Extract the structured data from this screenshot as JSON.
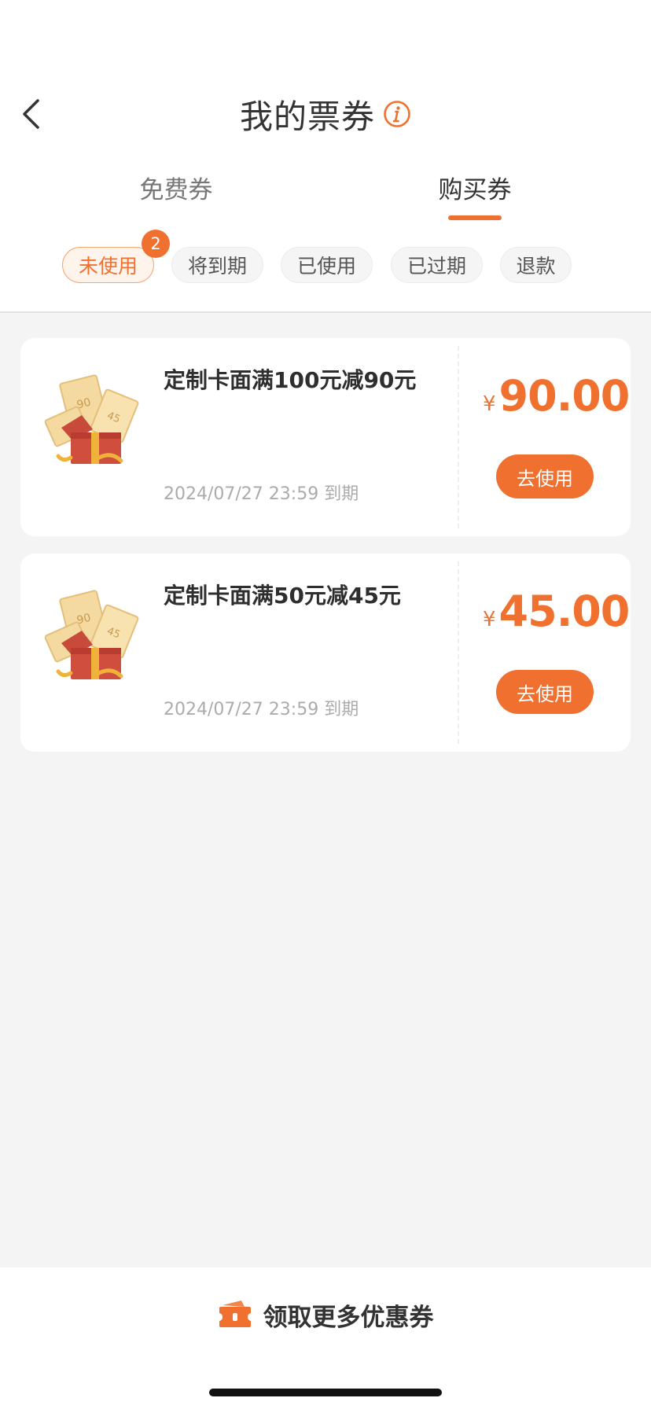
{
  "header": {
    "title": "我的票券"
  },
  "tabs": [
    {
      "label": "免费券"
    },
    {
      "label": "购买券"
    }
  ],
  "filters": [
    {
      "label": "未使用",
      "badge": "2"
    },
    {
      "label": "将到期"
    },
    {
      "label": "已使用"
    },
    {
      "label": "已过期"
    },
    {
      "label": "退款"
    }
  ],
  "coupons": [
    {
      "title": "定制卡面满100元减90元",
      "expire": "2024/07/27 23:59 到期",
      "currency": "¥",
      "amount": "90.00",
      "button": "去使用"
    },
    {
      "title": "定制卡面满50元减45元",
      "expire": "2024/07/27 23:59 到期",
      "currency": "¥",
      "amount": "45.00",
      "button": "去使用"
    }
  ],
  "bottom": {
    "label": "领取更多优惠券"
  },
  "colors": {
    "accent": "#f07030",
    "background": "#f4f4f4",
    "card": "#ffffff"
  },
  "icons": [
    "back-arrow-icon",
    "info-icon",
    "gift-box-coupon-icon",
    "ticket-icon"
  ]
}
